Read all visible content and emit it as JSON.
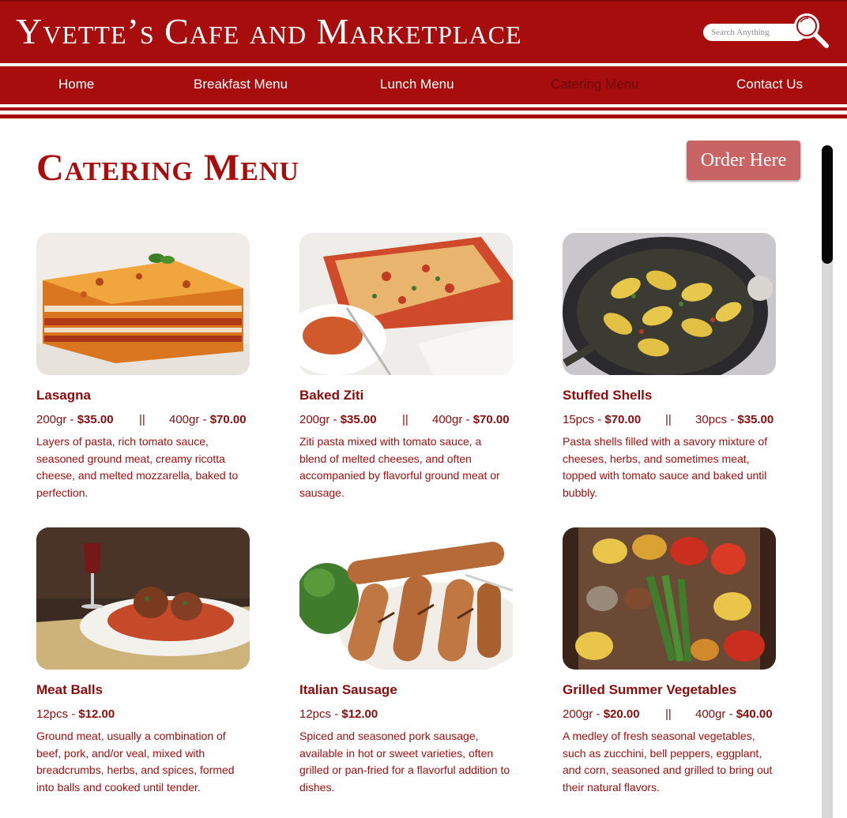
{
  "site": {
    "title": "Yvette’s Cafe and Marketplace"
  },
  "search": {
    "placeholder": "Search Anything"
  },
  "nav": {
    "items": [
      {
        "label": "Home"
      },
      {
        "label": "Breakfast Menu"
      },
      {
        "label": "Lunch Menu"
      },
      {
        "label": "Catering Menu"
      },
      {
        "label": "Contact Us"
      }
    ],
    "active": "Catering Menu"
  },
  "page": {
    "title": "Catering Menu",
    "order_label": "Order Here"
  },
  "menu": [
    {
      "name": "Lasagna",
      "price_a_qty": "200gr - ",
      "price_a_val": "$35.00",
      "sep": "||",
      "price_b_qty": "400gr - ",
      "price_b_val": "$70.00",
      "description": "Layers of pasta, rich tomato sauce, seasoned ground meat, creamy ricotta cheese, and melted mozzarella, baked to perfection."
    },
    {
      "name": "Baked Ziti",
      "price_a_qty": "200gr - ",
      "price_a_val": "$35.00",
      "sep": "||",
      "price_b_qty": "400gr - ",
      "price_b_val": "$70.00",
      "description": "Ziti pasta mixed with tomato sauce, a blend of melted cheeses, and often accompanied by flavorful ground meat or sausage."
    },
    {
      "name": "Stuffed Shells",
      "price_a_qty": "15pcs - ",
      "price_a_val": "$70.00",
      "sep": "||",
      "price_b_qty": "30pcs - ",
      "price_b_val": "$35.00",
      "description": "Pasta shells filled with a savory mixture of cheeses, herbs, and sometimes meat, topped with tomato sauce and baked until bubbly."
    },
    {
      "name": "Meat Balls",
      "price_a_qty": "12pcs - ",
      "price_a_val": "$12.00",
      "description": "Ground meat, usually a combination of beef, pork, and/or veal, mixed with breadcrumbs, herbs, and spices, formed into balls and cooked until tender."
    },
    {
      "name": "Italian Sausage",
      "price_a_qty": "12pcs - ",
      "price_a_val": "$12.00",
      "description": "Spiced and seasoned pork sausage, available in hot or sweet varieties, often grilled or pan-fried for a flavorful addition to dishes."
    },
    {
      "name": "Grilled Summer Vegetables",
      "price_a_qty": "200gr - ",
      "price_a_val": "$20.00",
      "sep": "||",
      "price_b_qty": "400gr - ",
      "price_b_val": "$40.00",
      "description": "A medley of fresh seasonal vegetables, such as zucchini, bell peppers, eggplant, and corn, seasoned and grilled to bring out their natural flavors."
    }
  ],
  "colors": {
    "brand_red": "#a70d0d",
    "button": "#c96464",
    "active_nav": "#6b0a0a"
  }
}
